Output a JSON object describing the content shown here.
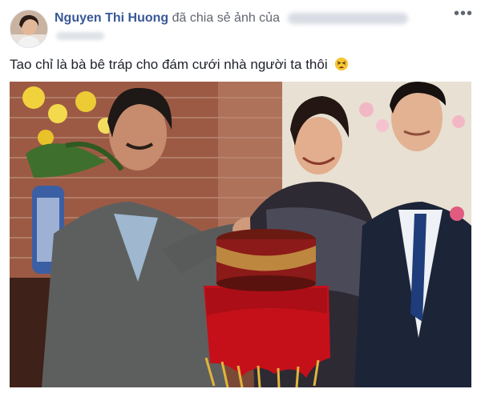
{
  "post": {
    "author_name": "Nguyen Thi Huong",
    "action_text": "đã chia sẻ ảnh của",
    "text": "Tao chỉ là bà bê tráp cho đám cưới nhà người ta thôi",
    "more_label": "•••",
    "emoji_icon": "tired-face-emoji-icon"
  },
  "colors": {
    "author": "#385898",
    "text": "#1d2129",
    "secondary": "#616770"
  }
}
